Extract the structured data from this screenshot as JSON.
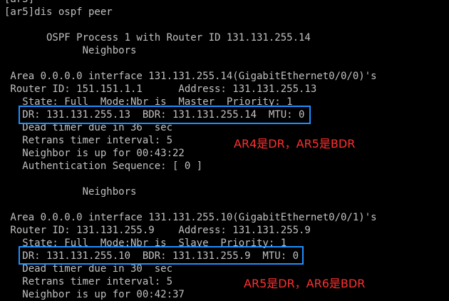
{
  "terminal": {
    "text_color": "#c0c0c0",
    "background": "#000000",
    "lines": [
      "[ar5]",
      "[ar5]dis ospf peer",
      "",
      "       OSPF Process 1 with Router ID 131.131.255.14",
      "             Neighbors",
      "",
      " Area 0.0.0.0 interface 131.131.255.14(GigabitEthernet0/0/0)'s",
      " Router ID: 151.151.1.1      Address: 131.131.255.13",
      "   State: Full  Mode:Nbr is  Master  Priority: 1",
      "   DR: 131.131.255.13  BDR: 131.131.255.14  MTU: 0",
      "   Dead timer due in 36  sec",
      "   Retrans timer interval: 5",
      "   Neighbor is up for 00:43:22",
      "   Authentication Sequence: [ 0 ]",
      "",
      "             Neighbors",
      "",
      " Area 0.0.0.0 interface 131.131.255.10(GigabitEthernet0/0/1)'s",
      " Router ID: 131.131.255.9    Address: 131.131.255.9",
      "   State: Full  Mode:Nbr is  Slave  Priority: 1",
      "   DR: 131.131.255.10  BDR: 131.131.255.9  MTU: 0",
      "   Dead timer due in 30  sec",
      "   Retrans timer interval: 5",
      "   Neighbor is up for 00:42:37"
    ]
  },
  "annotations": {
    "note1": "AR4是DR，AR5是BDR",
    "note2": "AR5是DR，AR6是BDR",
    "box_color": "#1f8fff",
    "note_color": "#ff3030"
  }
}
